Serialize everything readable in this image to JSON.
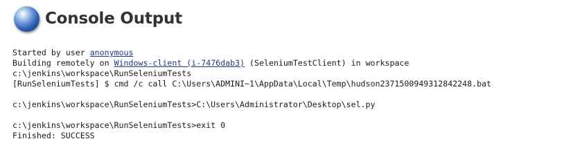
{
  "page": {
    "title": "Console Output",
    "icon": "status-ball-icon",
    "accent_color": "#2e5fb3"
  },
  "console": {
    "started_prefix": "Started by user ",
    "user_link": "anonymous",
    "building_prefix": "Building remotely on ",
    "node_link": "Windows-client (i-7476dab3)",
    "building_suffix": " (SeleniumTestClient) in workspace",
    "workspace_path": "c:\\jenkins\\workspace\\RunSeleniumTests",
    "cmd_line": "[RunSeleniumTests] $ cmd /c call C:\\Users\\ADMINI~1\\AppData\\Local\\Temp\\hudson2371500949312842248.bat",
    "prompt_line_1": "c:\\jenkins\\workspace\\RunSeleniumTests>C:\\Users\\Administrator\\Desktop\\sel.py",
    "prompt_line_2": "c:\\jenkins\\workspace\\RunSeleniumTests>exit 0",
    "finished_line": "Finished: SUCCESS"
  }
}
